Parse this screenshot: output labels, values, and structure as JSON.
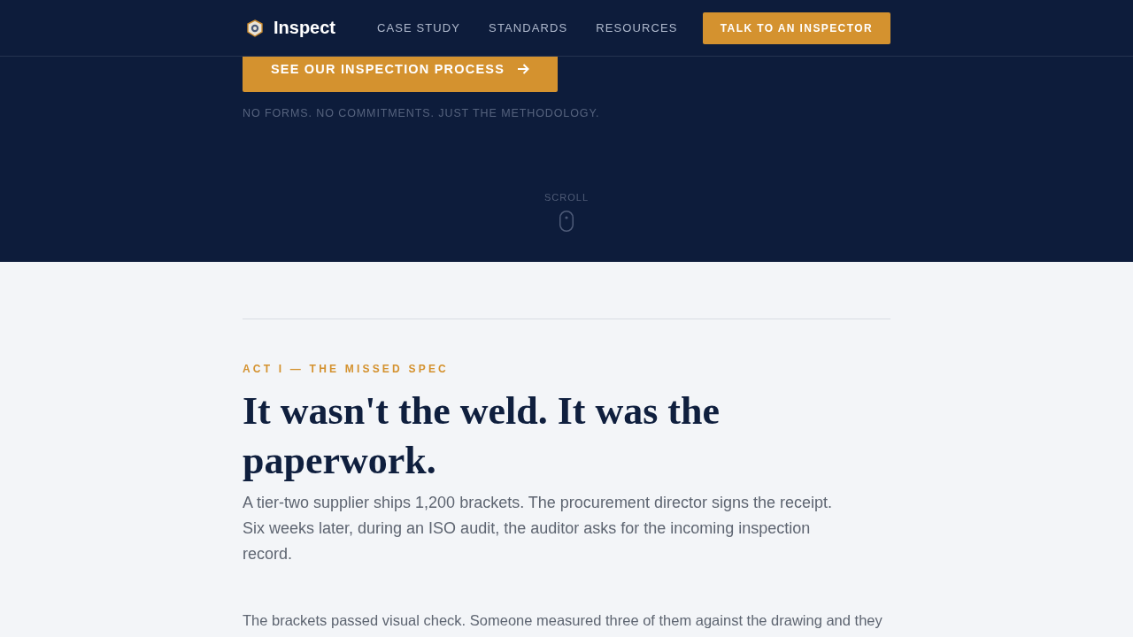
{
  "header": {
    "logo": {
      "text": "Inspect"
    },
    "nav": [
      {
        "label": "CASE STUDY"
      },
      {
        "label": "STANDARDS"
      },
      {
        "label": "RESOURCES"
      }
    ],
    "cta": {
      "label": "TALK TO AN INSPECTOR"
    }
  },
  "hero": {
    "cta": {
      "label": "SEE OUR INSPECTION PROCESS"
    },
    "note": "NO FORMS. NO COMMITMENTS. JUST THE METHODOLOGY.",
    "scroll_hint": "SCROLL"
  },
  "story": {
    "eyebrow": "ACT I — THE MISSED SPEC",
    "heading": "It wasn't the weld. It was the paperwork.",
    "lead": "A tier-two supplier ships 1,200 brackets. The procurement director signs the receipt. Six weeks later, during an ISO audit, the auditor asks for the incoming inspection record.",
    "body": [
      "The brackets passed visual check. Someone measured three of them against the drawing and they"
    ]
  }
}
